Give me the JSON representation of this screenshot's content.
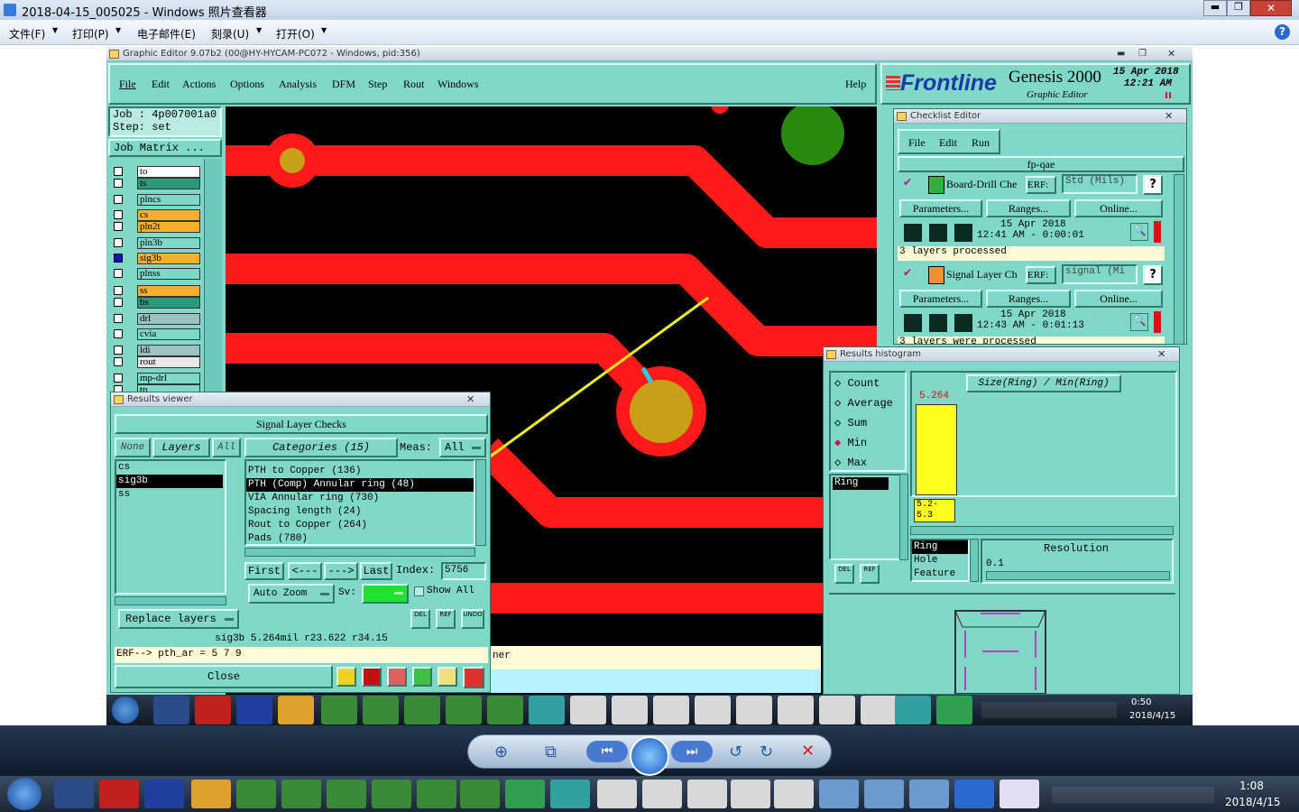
{
  "viewer": {
    "title": "2018-04-15_005025 - Windows 照片查看器",
    "menu": [
      "文件(F)",
      "打印(P)",
      "电子邮件(E)",
      "刻录(U)",
      "打开(O)"
    ],
    "help": "?"
  },
  "ge": {
    "title": "Graphic Editor 9.07b2 (00@HY-HYCAM-PC072 - Windows, pid:356)",
    "menu": [
      "File",
      "Edit",
      "Actions",
      "Options",
      "Analysis",
      "DFM",
      "Step",
      "Rout",
      "Windows"
    ],
    "help": "Help",
    "brand": "Frontline",
    "product": "Genesis 2000",
    "subtitle": "Graphic Editor",
    "date": "15 Apr 2018",
    "time": "12:21 AM",
    "job": "Job  : 4p007001a0",
    "step": "Step:  set",
    "job_matrix": "Job Matrix ..."
  },
  "layers": [
    {
      "name": "to",
      "color": "#ffffff"
    },
    {
      "name": "ts",
      "color": "#2a9a7a"
    },
    {
      "name": "plncs",
      "color": "#7fd8c8"
    },
    {
      "name": "cs",
      "color": "#f5b030"
    },
    {
      "name": "pln2t",
      "color": "#f5b030"
    },
    {
      "name": "pln3b",
      "color": "#7fd8c8"
    },
    {
      "name": "sig3b",
      "color": "#f5b030"
    },
    {
      "name": "plnss",
      "color": "#7fd8c8"
    },
    {
      "name": "ss",
      "color": "#f5b030"
    },
    {
      "name": "bs",
      "color": "#2a9a7a"
    },
    {
      "name": "drl",
      "color": "#9cc2c2"
    },
    {
      "name": "cvia",
      "color": "#7fd8c8"
    },
    {
      "name": "ldi",
      "color": "#9cc2c2"
    },
    {
      "name": "rout",
      "color": "#e8e8e8"
    },
    {
      "name": "mp-drl",
      "color": "#7fd8c8"
    },
    {
      "name": "tp",
      "color": "#7fd8c8"
    }
  ],
  "checklist": {
    "title": "Checklist Editor",
    "menu": [
      "File",
      "Edit",
      "Run"
    ],
    "name": "fp-qae",
    "items": [
      {
        "name": "Board-Drill Che",
        "erf": "ERF:",
        "erf_val": "Std (Mils)",
        "btns": [
          "Parameters...",
          "Ranges...",
          "Online..."
        ],
        "date": "15 Apr 2018",
        "time": "12:41 AM - 0:00:01",
        "status": "3 layers processed"
      },
      {
        "name": "Signal Layer Ch",
        "erf": "ERF:",
        "erf_val": "signal (Mi",
        "btns": [
          "Parameters...",
          "Ranges...",
          "Online..."
        ],
        "date": "15 Apr 2018",
        "time": "12:43 AM - 0:01:13",
        "status": "3 layers were processed"
      }
    ]
  },
  "results_viewer": {
    "title": "Results viewer",
    "heading": "Signal Layer Checks",
    "none": "None",
    "layers": "Layers",
    "all": "All",
    "categories": "Categories (15)",
    "meas": "Meas:",
    "meas_val": "All",
    "layer_list": [
      "cs",
      "sig3b",
      "ss"
    ],
    "category_list": [
      "PTH to Copper (136)",
      "PTH (Comp) Annular ring (48)",
      "VIA Annular ring (730)",
      "Spacing length (24)",
      "Rout to Copper (264)",
      "Pads (780)"
    ],
    "nav": [
      "First",
      "<---",
      "--->",
      "Last"
    ],
    "index_label": "Index:",
    "index": "5756",
    "auto_zoom": "Auto Zoom",
    "sv": "Sv:",
    "show_all": "Show All",
    "replace": "Replace layers",
    "tool_btns": [
      "DEL",
      "REF",
      "UNDO"
    ],
    "info": "sig3b 5.264mil   r23.622  r34.15",
    "erf": "ERF--> pth_ar = 5 7 9",
    "close": "Close"
  },
  "histogram": {
    "title": "Results histogram",
    "options": [
      "Count",
      "Average",
      "Sum",
      "Min",
      "Max"
    ],
    "selected": "Min",
    "label": "Size(Ring) / Min(Ring)",
    "bar_value": "5.264",
    "bar_fraction": 0.78,
    "range": [
      "5.2-",
      "5.3"
    ],
    "list_sel": "Ring",
    "feature_list": [
      "Ring",
      "Hole",
      "Feature"
    ],
    "resolution": "Resolution",
    "res_val": "0.1",
    "btns": [
      "DEL",
      "REF"
    ]
  },
  "inner_taskbar": {
    "time": "0:50",
    "date": "2018/4/15"
  },
  "outer_taskbar": {
    "time": "1:08",
    "date": "2018/4/15"
  },
  "canvas_bottom_text": "ner",
  "colors": {
    "trace": "#ff1a1a",
    "pad": "#c8a018",
    "green_pad": "#2a8a10",
    "arrow": "#f0f020",
    "panel": "#7fd8c8"
  }
}
